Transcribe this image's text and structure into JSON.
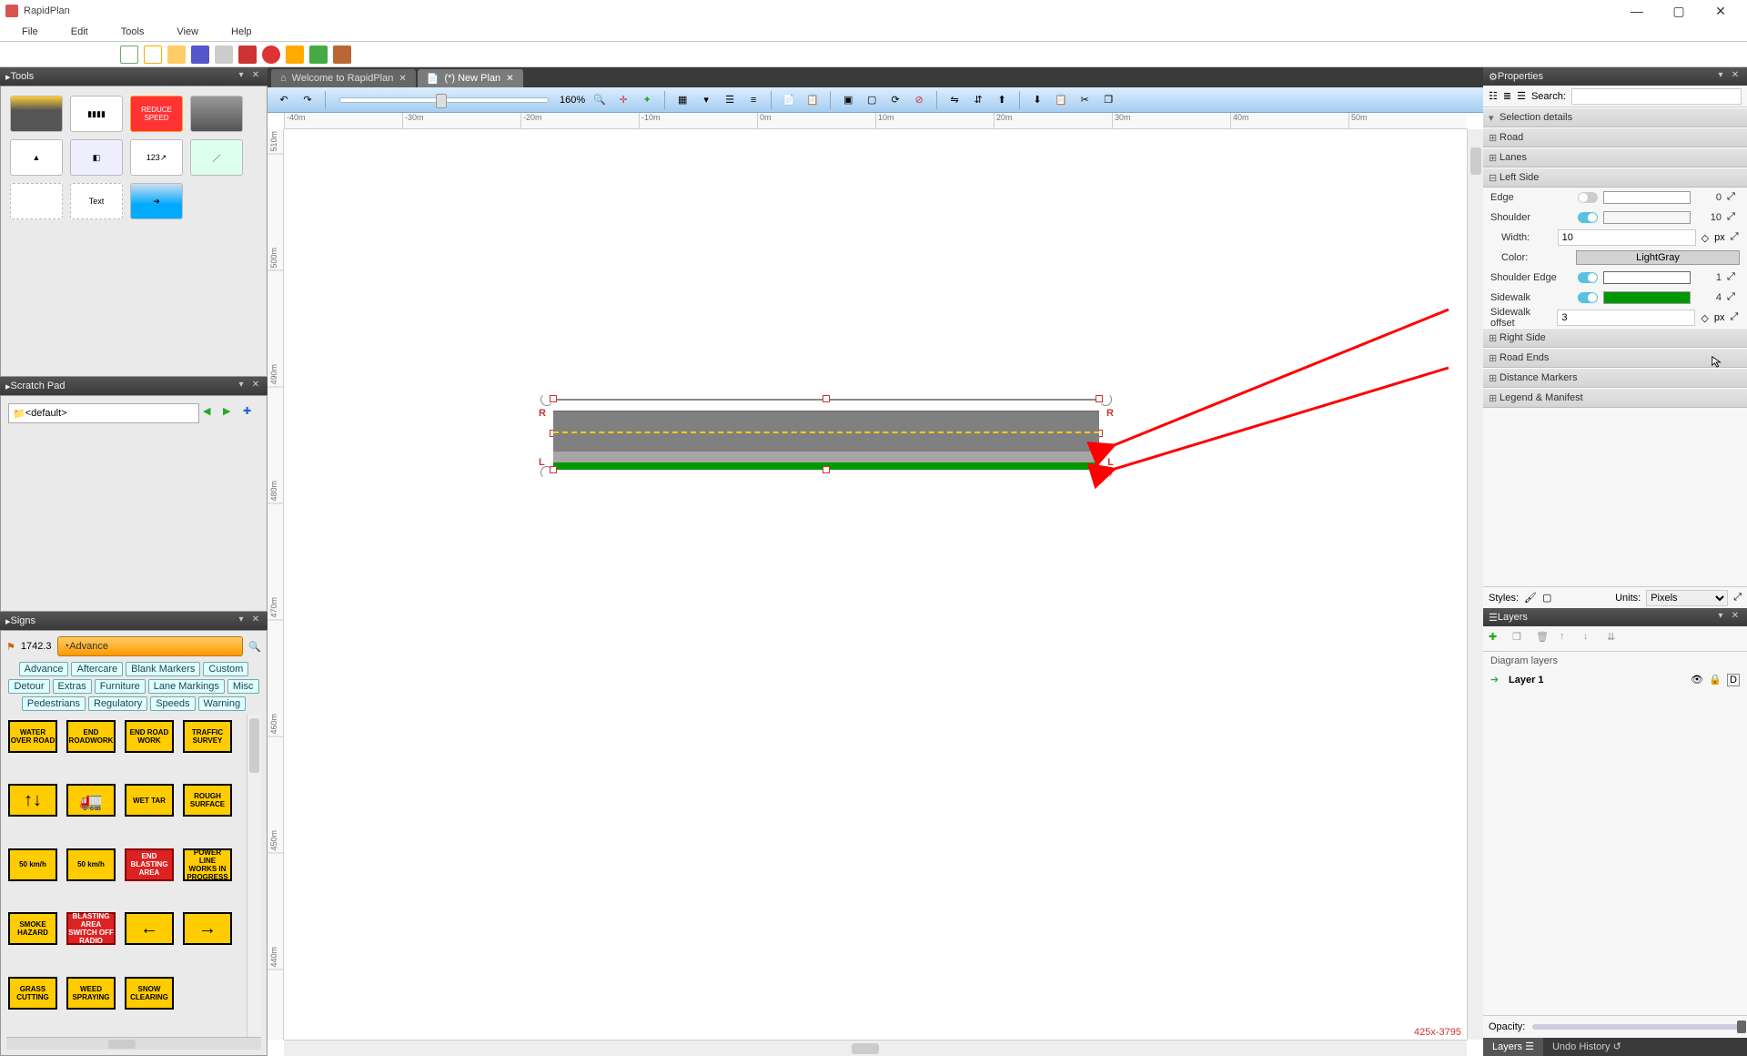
{
  "app": {
    "title": "RapidPlan"
  },
  "menu": [
    "File",
    "Edit",
    "Tools",
    "View",
    "Help"
  ],
  "doc_tabs": [
    {
      "label": "Welcome to RapidPlan",
      "active": false
    },
    {
      "label": "(*) New Plan",
      "active": true
    }
  ],
  "zoom_label": "160%",
  "h_ruler_ticks": [
    "-40m",
    "-30m",
    "-20m",
    "-10m",
    "0m",
    "10m",
    "20m",
    "30m",
    "40m",
    "50m"
  ],
  "v_ruler_ticks": [
    "510m",
    "500m",
    "490m",
    "480m",
    "470m",
    "460m",
    "450m",
    "440m"
  ],
  "coord_readout": "425x-3795",
  "panels": {
    "tools": {
      "title": "Tools"
    },
    "scratch": {
      "title": "Scratch Pad",
      "default_item": "<default>"
    },
    "signs": {
      "title": "Signs",
      "code": "1742.3",
      "category": "Advance",
      "filters": [
        "Advance",
        "Aftercare",
        "Blank Markers",
        "Custom",
        "Detour",
        "Extras",
        "Furniture",
        "Lane Markings",
        "Misc",
        "Pedestrians",
        "Regulatory",
        "Speeds",
        "Warning"
      ],
      "items": [
        {
          "label": "WATER OVER ROAD",
          "cls": "y"
        },
        {
          "label": "END ROADWORK",
          "cls": "y"
        },
        {
          "label": "END ROAD WORK",
          "cls": "y"
        },
        {
          "label": "TRAFFIC SURVEY",
          "cls": "y"
        },
        {
          "label": "↑↓",
          "cls": "y arrow"
        },
        {
          "label": "🚛",
          "cls": "y arrow"
        },
        {
          "label": "WET TAR",
          "cls": "y"
        },
        {
          "label": "ROUGH SURFACE",
          "cls": "y"
        },
        {
          "label": "50 km/h",
          "cls": "y"
        },
        {
          "label": "50 km/h",
          "cls": "y"
        },
        {
          "label": "END BLASTING AREA",
          "cls": "r"
        },
        {
          "label": "POWER LINE WORKS IN PROGRESS",
          "cls": "y"
        },
        {
          "label": "SMOKE HAZARD",
          "cls": "y"
        },
        {
          "label": "BLASTING AREA SWITCH OFF RADIO",
          "cls": "r"
        },
        {
          "label": "←",
          "cls": "y arrow"
        },
        {
          "label": "→",
          "cls": "y arrow"
        },
        {
          "label": "GRASS CUTTING",
          "cls": "y"
        },
        {
          "label": "WEED SPRAYING",
          "cls": "y"
        },
        {
          "label": "SNOW CLEARING",
          "cls": "y"
        }
      ]
    }
  },
  "props": {
    "title": "Properties",
    "search_label": "Search:",
    "sections_collapsed": [
      "Selection details",
      "Road",
      "Lanes",
      "Right Side",
      "Road Ends",
      "Distance Markers",
      "Legend & Manifest"
    ],
    "left_side": {
      "title": "Left Side",
      "edge": {
        "label": "Edge",
        "on": false,
        "value": "0"
      },
      "shoulder": {
        "label": "Shoulder",
        "on": true,
        "value": "10",
        "swatch": "#a6a6a6"
      },
      "width": {
        "label": "Width:",
        "value": "10",
        "unit": "px"
      },
      "color": {
        "label": "Color:",
        "value": "LightGray",
        "hex": "#d3d3d3"
      },
      "shoulder_edge": {
        "label": "Shoulder Edge",
        "on": true,
        "value": "1"
      },
      "sidewalk": {
        "label": "Sidewalk",
        "on": true,
        "value": "4",
        "swatch": "#009800"
      },
      "sidewalk_offset": {
        "label": "Sidewalk offset",
        "value": "3",
        "unit": "px"
      }
    },
    "styles_label": "Styles:",
    "units_label": "Units:",
    "units_value": "Pixels"
  },
  "layers": {
    "title": "Layers",
    "section_label": "Diagram layers",
    "row_name": "Layer 1",
    "opacity_label": "Opacity:",
    "bottom_tabs": [
      "Layers",
      "Undo History"
    ]
  }
}
